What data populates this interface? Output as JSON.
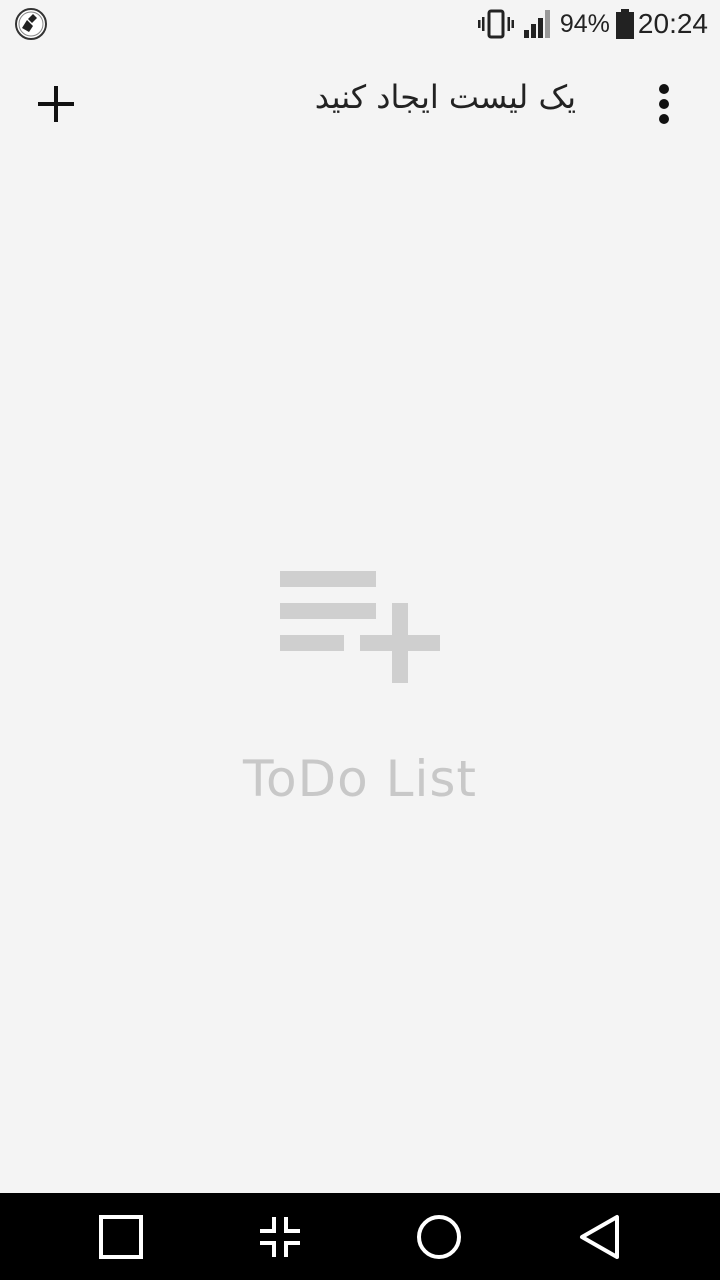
{
  "status_bar": {
    "app_icon": "cleaner-broom-icon",
    "vibrate_icon": "vibrate-icon",
    "signal_icon": "cell-signal-icon",
    "battery_percent": "94%",
    "battery_icon": "battery-icon",
    "time": "20:24"
  },
  "toolbar": {
    "add_icon": "plus-icon",
    "title": "یک لیست ایجاد کنید",
    "overflow_icon": "more-vertical-icon"
  },
  "empty_state": {
    "icon": "playlist-add-icon",
    "label": "ToDo List",
    "icon_color": "#cfcfcf"
  },
  "nav_bar": {
    "recents_icon": "square-icon",
    "collapse_icon": "collapse-icon",
    "home_icon": "circle-icon",
    "back_icon": "triangle-back-icon"
  },
  "colors": {
    "background": "#f4f4f4",
    "nav_background": "#000000",
    "text_primary": "#222222",
    "empty_text": "#c8c8c8"
  }
}
